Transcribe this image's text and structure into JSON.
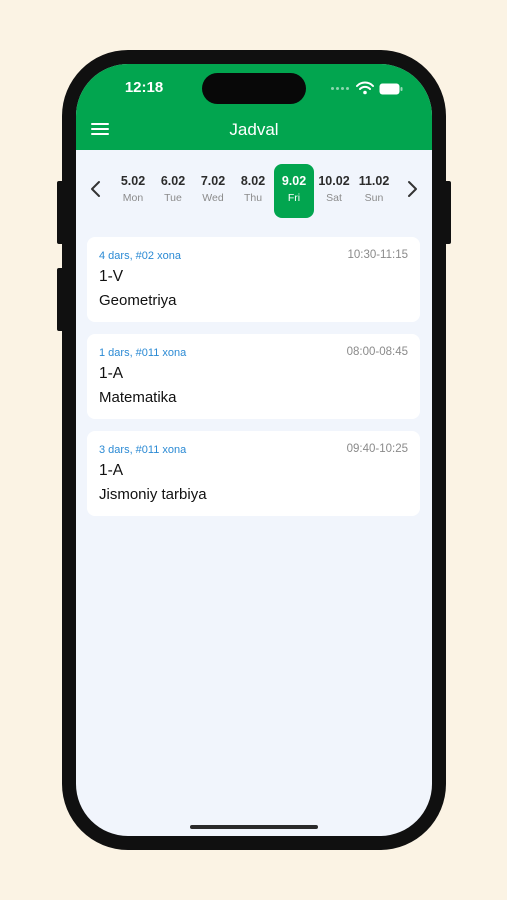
{
  "status_bar": {
    "time": "12:18"
  },
  "header": {
    "title": "Jadval"
  },
  "icons": {
    "menu": "hamburger-menu-icon",
    "prev": "chevron-left-icon",
    "next": "chevron-right-icon",
    "wifi": "wifi-icon",
    "battery": "battery-icon"
  },
  "colors": {
    "brand": "#02a54f",
    "link": "#2b8ad4",
    "background": "#f1f5fc",
    "outside": "#fbf3e4"
  },
  "days": [
    {
      "date": "5.02",
      "weekday": "Mon",
      "selected": false
    },
    {
      "date": "6.02",
      "weekday": "Tue",
      "selected": false
    },
    {
      "date": "7.02",
      "weekday": "Wed",
      "selected": false
    },
    {
      "date": "8.02",
      "weekday": "Thu",
      "selected": false
    },
    {
      "date": "9.02",
      "weekday": "Fri",
      "selected": true
    },
    {
      "date": "10.02",
      "weekday": "Sat",
      "selected": false
    },
    {
      "date": "11.02",
      "weekday": "Sun",
      "selected": false
    }
  ],
  "lessons": [
    {
      "meta": "4 dars, #02 xona",
      "time": "10:30-11:15",
      "class_name": "1-V",
      "subject": "Geometriya"
    },
    {
      "meta": "1 dars, #011 xona",
      "time": "08:00-08:45",
      "class_name": "1-A",
      "subject": "Matematika"
    },
    {
      "meta": "3 dars, #011 xona",
      "time": "09:40-10:25",
      "class_name": "1-A",
      "subject": "Jismoniy tarbiya"
    }
  ]
}
